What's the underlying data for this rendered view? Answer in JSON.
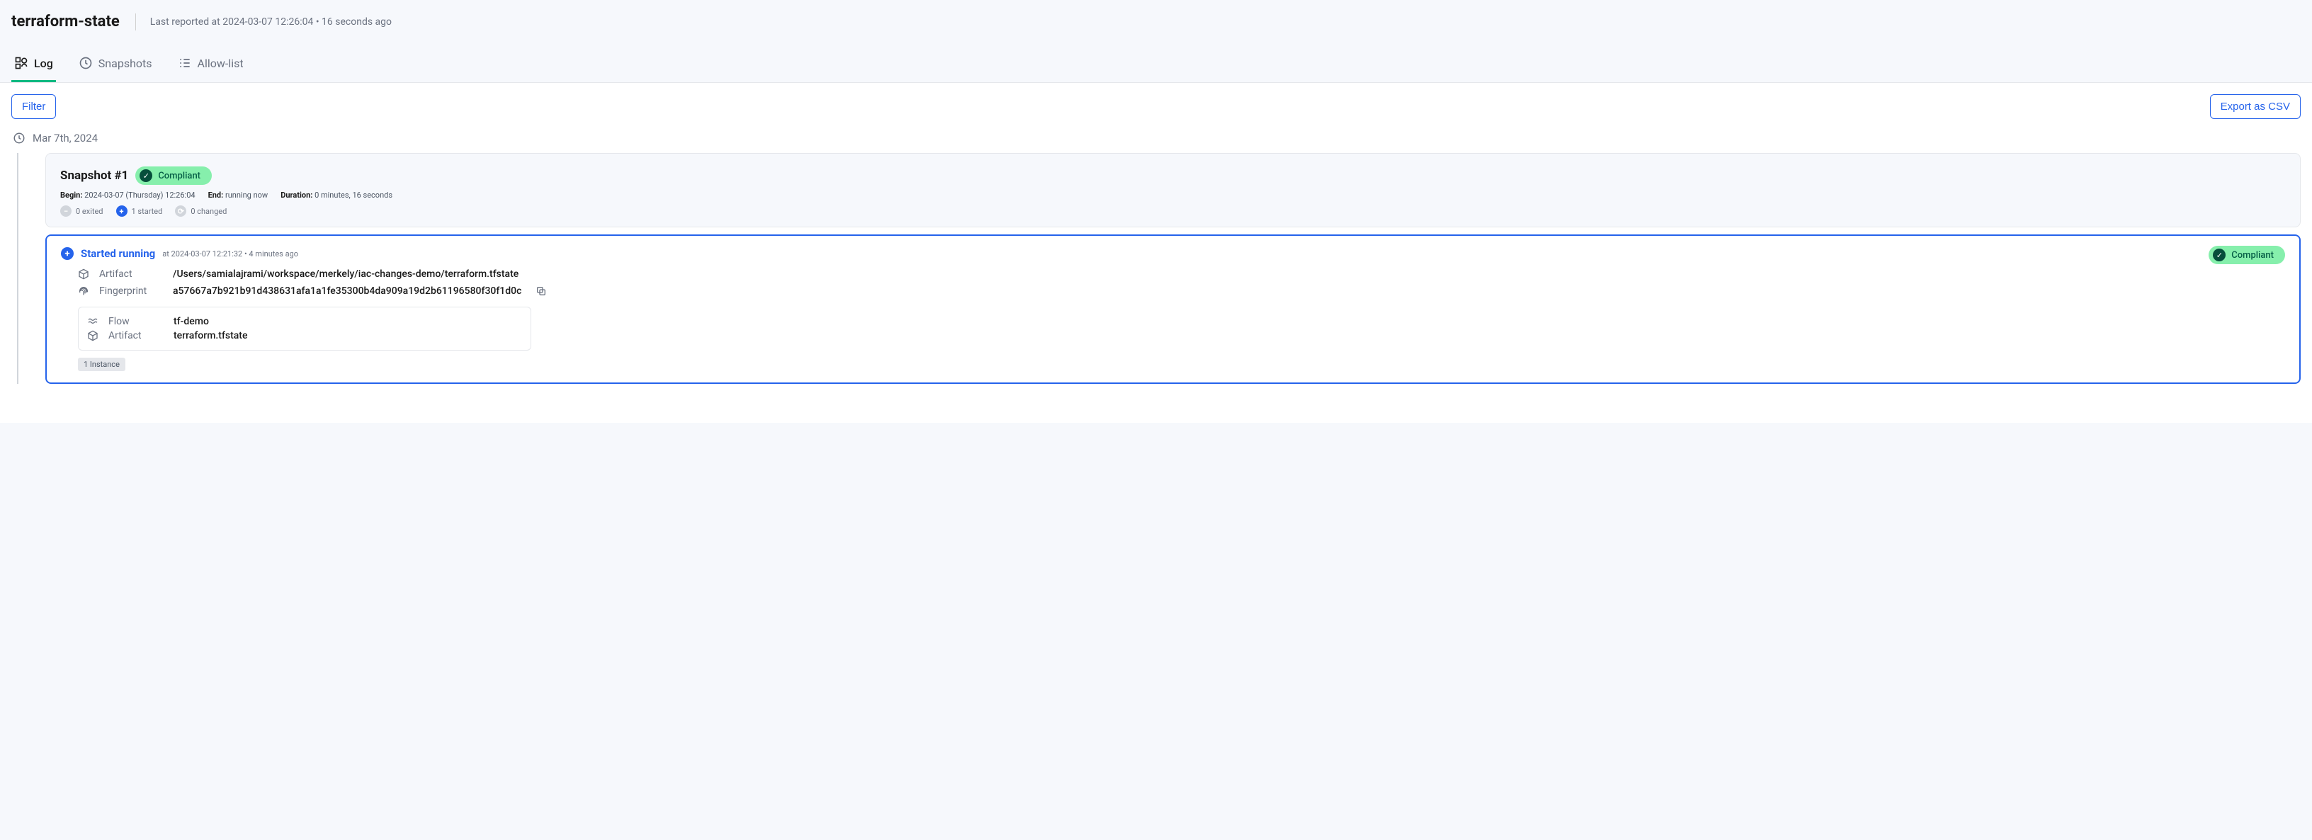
{
  "header": {
    "title": "terraform-state",
    "subtitle": "Last reported at 2024-03-07 12:26:04 • 16 seconds ago"
  },
  "tabs": {
    "log": "Log",
    "snapshots": "Snapshots",
    "allowlist": "Allow-list"
  },
  "actions": {
    "filter": "Filter",
    "export": "Export as CSV"
  },
  "date_label": "Mar 7th, 2024",
  "snapshot": {
    "title": "Snapshot #1",
    "badge": "Compliant",
    "begin_label": "Begin:",
    "begin_value": "2024-03-07 (Thursday) 12:26:04",
    "end_label": "End:",
    "end_value": "running now",
    "duration_label": "Duration:",
    "duration_value": "0 minutes, 16 seconds",
    "exited": "0 exited",
    "started": "1 started",
    "changed": "0 changed"
  },
  "event": {
    "title": "Started running",
    "at_text": "at 2024-03-07 12:21:32 • 4 minutes ago",
    "badge": "Compliant",
    "artifact_label": "Artifact",
    "artifact_value": "/Users/samialajrami/workspace/merkely/iac-changes-demo/terraform.tfstate",
    "fingerprint_label": "Fingerprint",
    "fingerprint_value": "a57667a7b921b91d438631afa1a1fe35300b4da909a19d2b61196580f30f1d0c",
    "flow_label": "Flow",
    "flow_value": "tf-demo",
    "artifact2_label": "Artifact",
    "artifact2_value": "terraform.tfstate",
    "instance": "1 Instance"
  }
}
